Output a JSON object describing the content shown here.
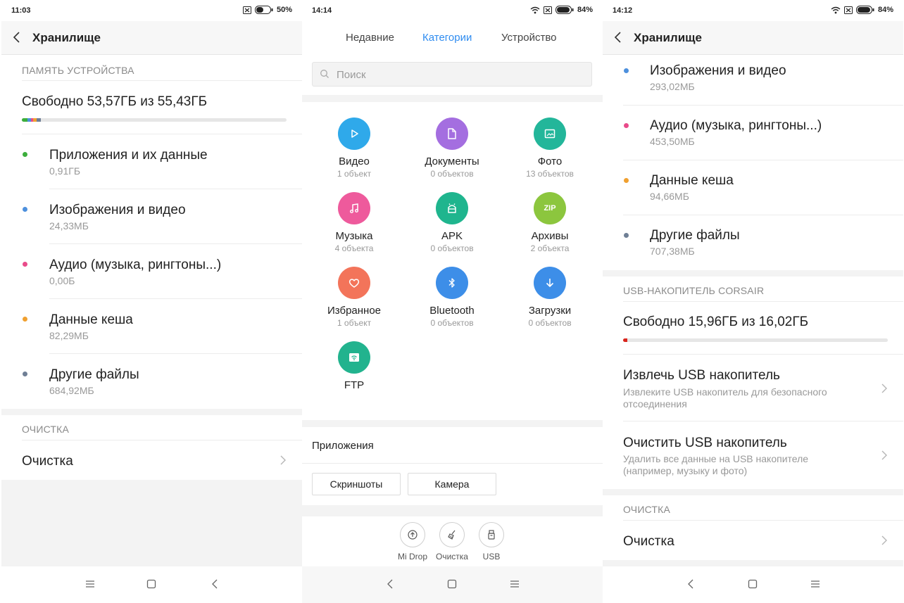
{
  "screen1": {
    "status": {
      "time": "11:03",
      "battery": "50%"
    },
    "title": "Хранилище",
    "section_device": "ПАМЯТЬ УСТРОЙСТВА",
    "free_text": "Свободно 53,57ГБ из 55,43ГБ",
    "usage_fraction": 0.033,
    "categories": [
      {
        "name": "Приложения и их данные",
        "size": "0,91ГБ",
        "color": "#3cae3c"
      },
      {
        "name": "Изображения и видео",
        "size": "24,33МБ",
        "color": "#4d90dd"
      },
      {
        "name": "Аудио (музыка, рингтоны...)",
        "size": "0,00Б",
        "color": "#e94b8a"
      },
      {
        "name": "Данные кеша",
        "size": "82,29МБ",
        "color": "#f0a030"
      },
      {
        "name": "Другие файлы",
        "size": "684,92МБ",
        "color": "#6f7f95"
      }
    ],
    "section_cleanup": "ОЧИСТКА",
    "cleanup_label": "Очистка"
  },
  "screen2": {
    "status": {
      "time": "14:14",
      "battery": "84%"
    },
    "tabs": [
      {
        "label": "Недавние"
      },
      {
        "label": "Категории"
      },
      {
        "label": "Устройство"
      }
    ],
    "search_placeholder": "Поиск",
    "tiles": [
      {
        "name": "Видео",
        "count": "1 объект",
        "color": "#2fa9ea",
        "icon": "play-icon"
      },
      {
        "name": "Документы",
        "count": "0 объектов",
        "color": "#a46ee0",
        "icon": "document-icon"
      },
      {
        "name": "Фото",
        "count": "13 объектов",
        "color": "#23b69a",
        "icon": "photo-icon"
      },
      {
        "name": "Музыка",
        "count": "4 объекта",
        "color": "#ee5a9c",
        "icon": "music-icon"
      },
      {
        "name": "APK",
        "count": "0 объектов",
        "color": "#1fb58e",
        "icon": "android-icon"
      },
      {
        "name": "Архивы",
        "count": "2 объекта",
        "color": "#8cc63e",
        "icon": "zip-icon",
        "icon_text": "ZIP"
      },
      {
        "name": "Избранное",
        "count": "1 объект",
        "color": "#f3745a",
        "icon": "heart-icon"
      },
      {
        "name": "Bluetooth",
        "count": "0 объектов",
        "color": "#3d8ee8",
        "icon": "bluetooth-icon"
      },
      {
        "name": "Загрузки",
        "count": "0 объектов",
        "color": "#3d8ee8",
        "icon": "download-icon"
      },
      {
        "name": "FTP",
        "count": "",
        "color": "#22b38e",
        "icon": "ftp-icon"
      }
    ],
    "apps_title": "Приложения",
    "app_chips": [
      "Скриншоты",
      "Камера"
    ],
    "tools": [
      {
        "label": "Mi Drop",
        "icon": "midrop-icon"
      },
      {
        "label": "Очистка",
        "icon": "broom-icon"
      },
      {
        "label": "USB",
        "icon": "usb-icon"
      }
    ]
  },
  "screen3": {
    "status": {
      "time": "14:12",
      "battery": "84%"
    },
    "title": "Хранилище",
    "categories": [
      {
        "name": "Изображения и видео",
        "size": "293,02МБ",
        "color": "#4d90dd"
      },
      {
        "name": "Аудио (музыка, рингтоны...)",
        "size": "453,50МБ",
        "color": "#e94b8a"
      },
      {
        "name": "Данные кеша",
        "size": "94,66МБ",
        "color": "#f0a030"
      },
      {
        "name": "Другие файлы",
        "size": "707,38МБ",
        "color": "#6f7f95"
      }
    ],
    "section_usb": "USB-НАКОПИТЕЛЬ CORSAIR",
    "usb_free_text": "Свободно 15,96ГБ из 16,02ГБ",
    "usb_usage_fraction": 0.004,
    "usb_usage_color": "#d9251d",
    "eject": {
      "label": "Извлечь USB накопитель",
      "sub": "Извлеките USB накопитель для безопасного отсоединения"
    },
    "format": {
      "label": "Очистить USB накопитель",
      "sub": "Удалить все данные на USB накопителе (например, музыку и фото)"
    },
    "section_cleanup": "ОЧИСТКА",
    "cleanup_label": "Очистка"
  }
}
